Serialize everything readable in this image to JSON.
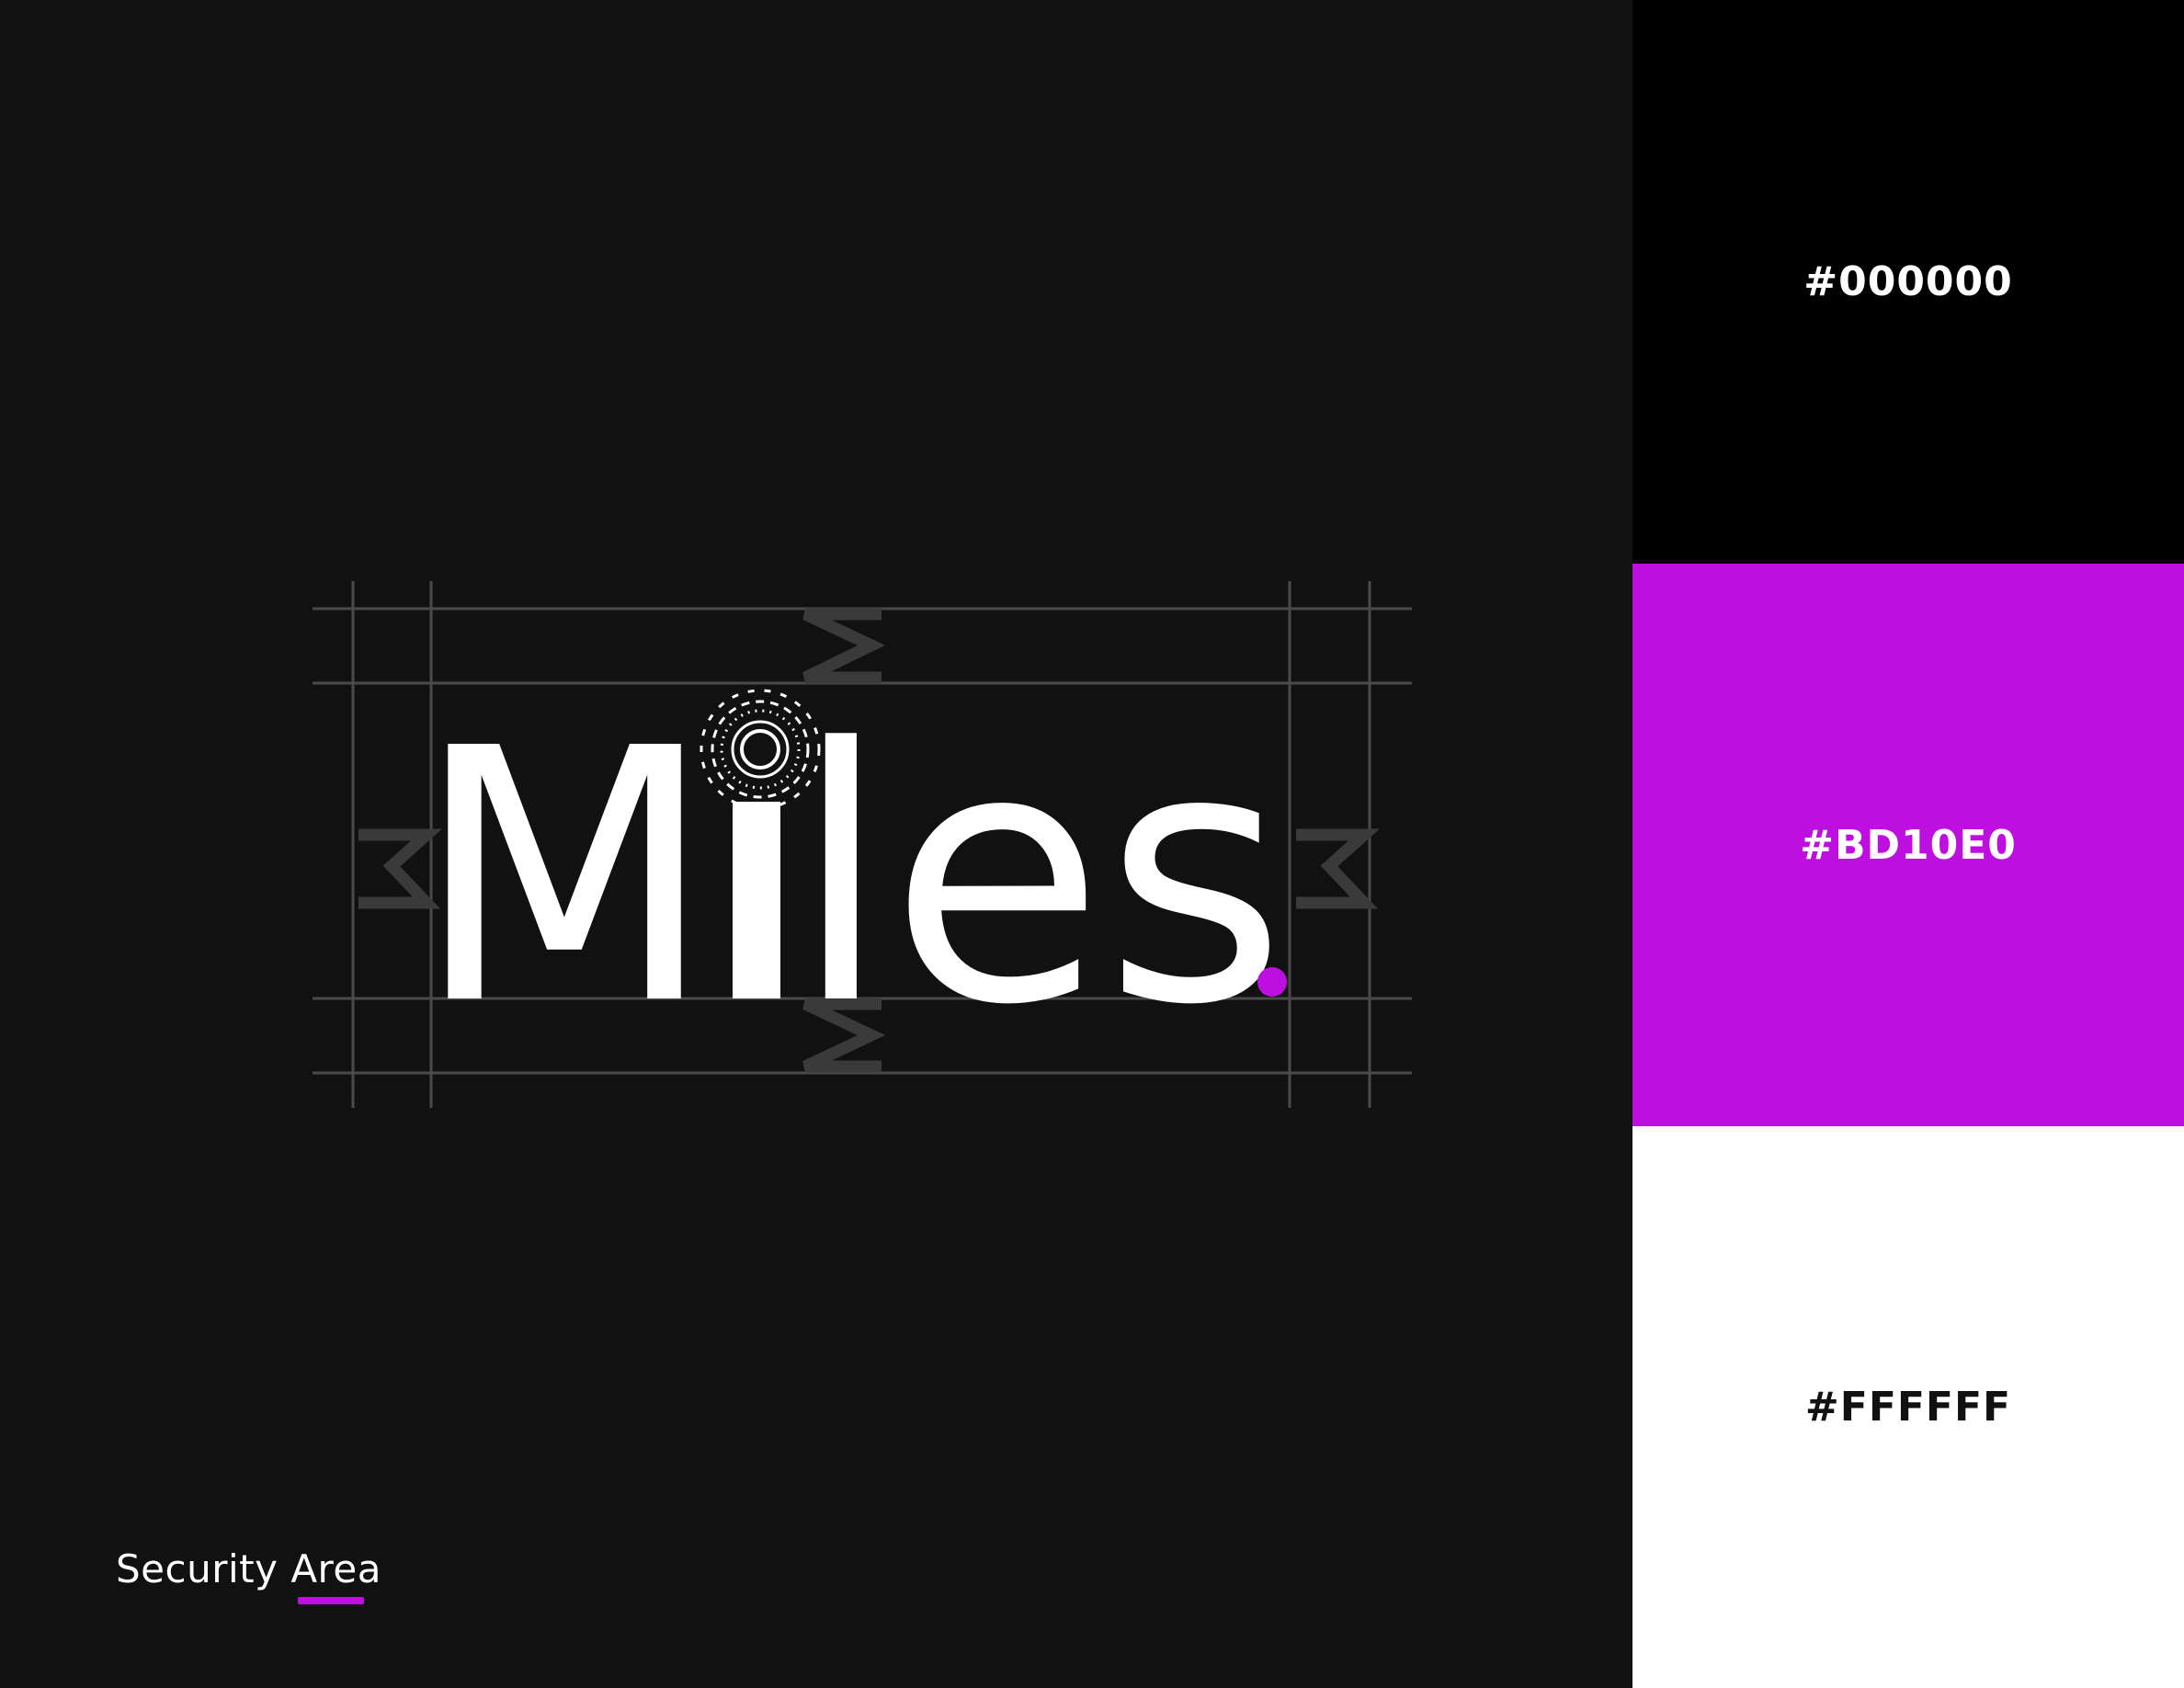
{
  "logo": {
    "wordmark_start": "M",
    "wordmark_end": "les"
  },
  "section": {
    "label": "Security Area"
  },
  "palette": [
    {
      "hex": "#000000",
      "label": "#000000",
      "text_color": "#FFFFFF"
    },
    {
      "hex": "#BD10E0",
      "label": "#BD10E0",
      "text_color": "#FFFFFF"
    },
    {
      "hex": "#FFFFFF",
      "label": "#FFFFFF",
      "text_color": "#111111"
    }
  ],
  "colors": {
    "background": "#111111",
    "accent": "#BD10E0",
    "guide": "#4A4A4A",
    "marker": "#3A3A3A",
    "wordmark": "#FFFFFF"
  },
  "icons": [
    "sun-burst-icon",
    "m-spacing-marker-icon"
  ]
}
